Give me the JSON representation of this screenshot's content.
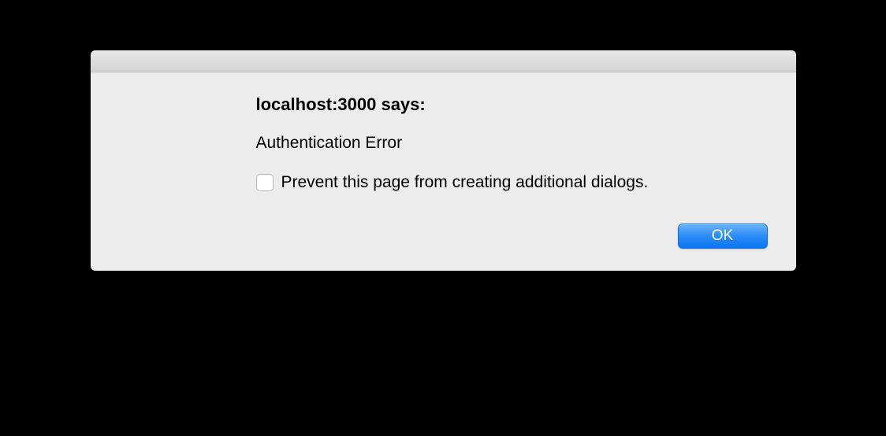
{
  "dialog": {
    "heading": "localhost:3000 says:",
    "message": "Authentication Error",
    "checkbox_label": "Prevent this page from creating additional dialogs.",
    "ok_label": "OK"
  }
}
